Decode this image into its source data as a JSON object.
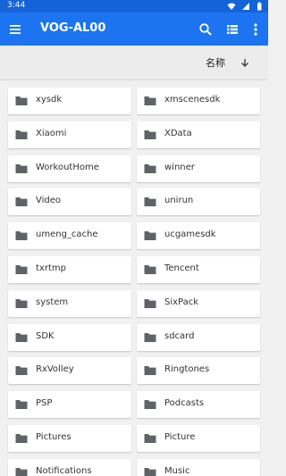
{
  "status_bar": {
    "time": "3:44"
  },
  "toolbar": {
    "title": "VOG-AL00",
    "icons": [
      "menu-icon",
      "search-icon",
      "list-view-icon",
      "more-vert-icon"
    ]
  },
  "sort": {
    "label": "名称"
  },
  "folders": [
    "xysdk",
    "xmscenesdk",
    "Xiaomi",
    "XData",
    "WorkoutHome",
    "winner",
    "Video",
    "unirun",
    "umeng_cache",
    "ucgamesdk",
    "txrtmp",
    "Tencent",
    "system",
    "SixPack",
    "SDK",
    "sdcard",
    "RxVolley",
    "Ringtones",
    "PSP",
    "Podcasts",
    "Pictures",
    "Picture",
    "Notifications",
    "Music"
  ],
  "colors": {
    "toolbar": "#1c74f0",
    "status": "#1463d8",
    "folder_icon": "#5f6368"
  }
}
